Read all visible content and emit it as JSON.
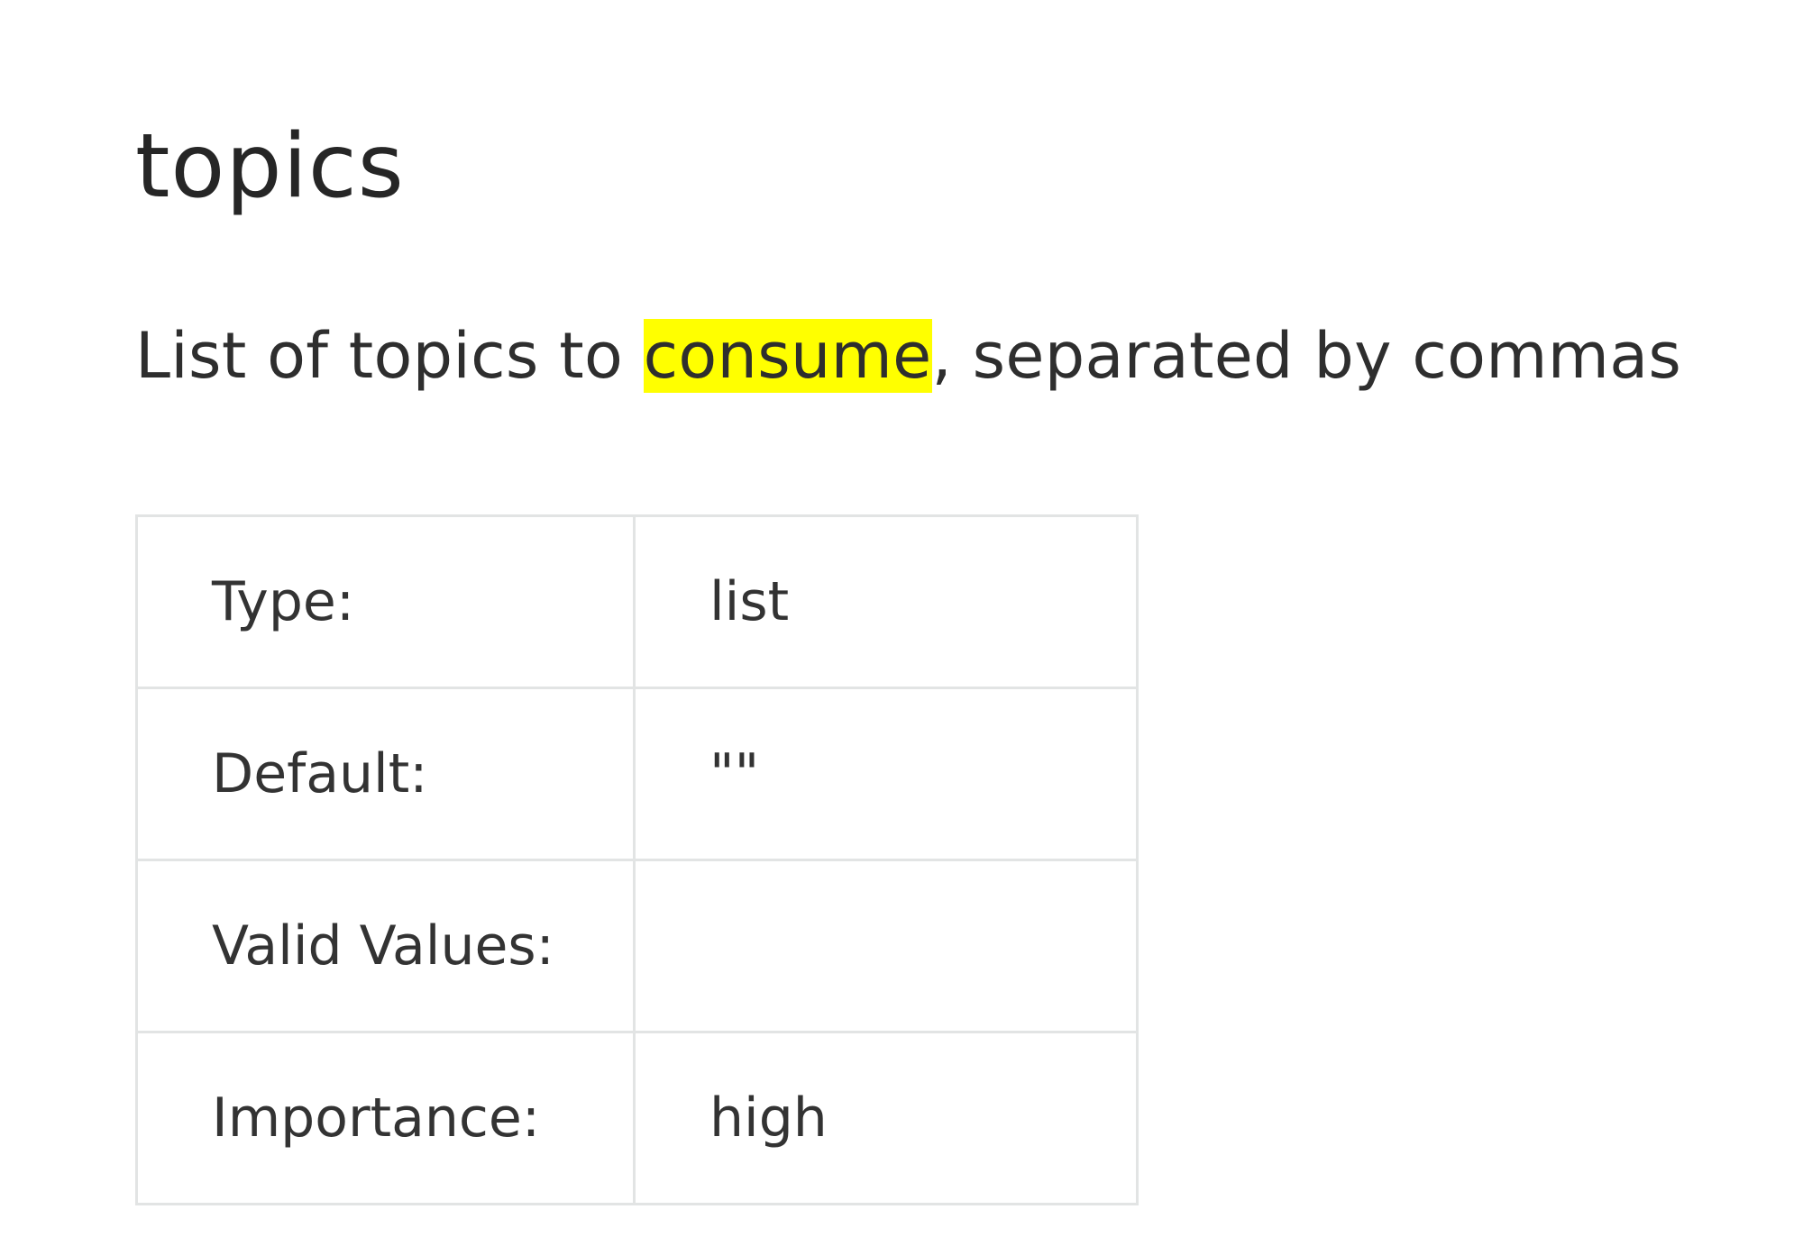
{
  "config": {
    "name": "topics",
    "description": {
      "before": "List of topics to ",
      "highlighted": "consume",
      "after": ", separated by commas"
    },
    "highlight_color": "#ffff00",
    "rows": [
      {
        "label": "Type:",
        "value": "list"
      },
      {
        "label": "Default:",
        "value": "\"\""
      },
      {
        "label": "Valid Values:",
        "value": ""
      },
      {
        "label": "Importance:",
        "value": "high"
      }
    ]
  }
}
